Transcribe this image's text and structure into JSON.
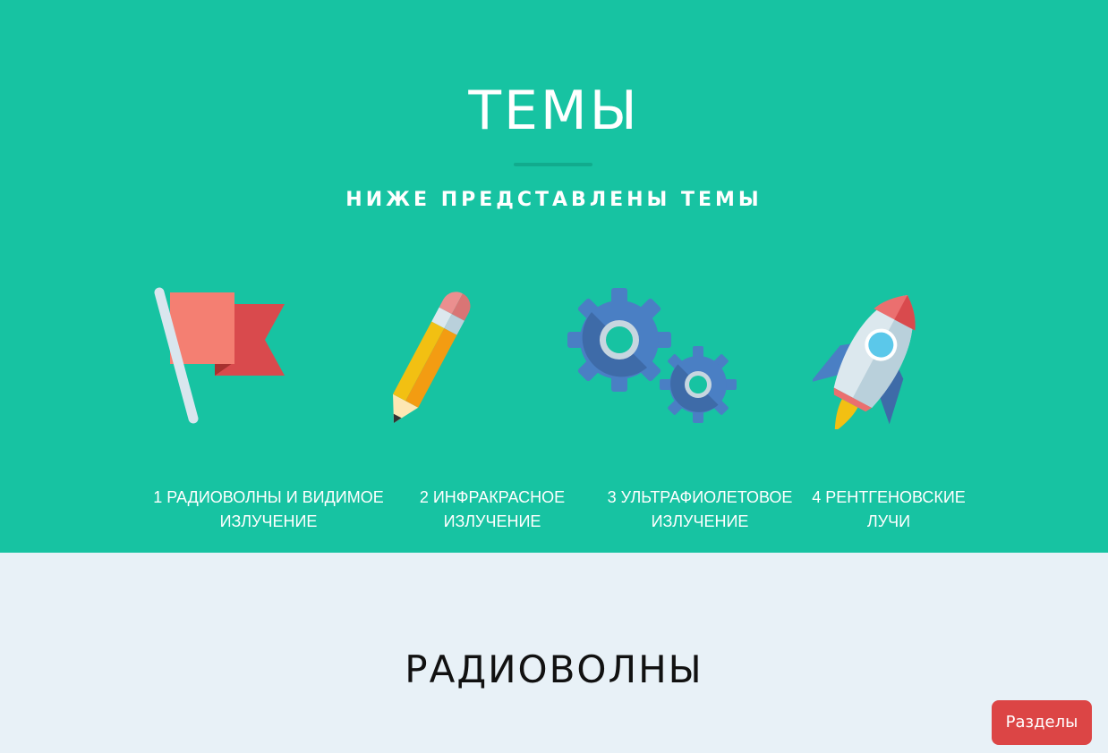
{
  "hero": {
    "title": "ТЕМЫ",
    "subtitle": "НИЖЕ ПРЕДСТАВЛЕНЫ ТЕМЫ",
    "background_color": "#17c3a2"
  },
  "topics": [
    {
      "icon": "flag-icon",
      "label_line1": "1 РАДИОВОЛНЫ И ВИДИМОЕ",
      "label_line2": "ИЗЛУЧЕНИЕ"
    },
    {
      "icon": "pencil-icon",
      "label_line1": "2 ИНФРАКРАСНОЕ",
      "label_line2": "ИЗЛУЧЕНИЕ"
    },
    {
      "icon": "gears-icon",
      "label_line1": "3 УЛЬТРАФИОЛЕТОВОЕ",
      "label_line2": "ИЗЛУЧЕНИЕ"
    },
    {
      "icon": "rocket-icon",
      "label_line1": "4 РЕНТГЕНОВСКИЕ",
      "label_line2": "ЛУЧИ"
    }
  ],
  "section": {
    "title": "РАДИОВОЛНЫ",
    "background_color": "#e8f1f7"
  },
  "nav_button": {
    "label": "Разделы",
    "color": "#dc4545"
  }
}
